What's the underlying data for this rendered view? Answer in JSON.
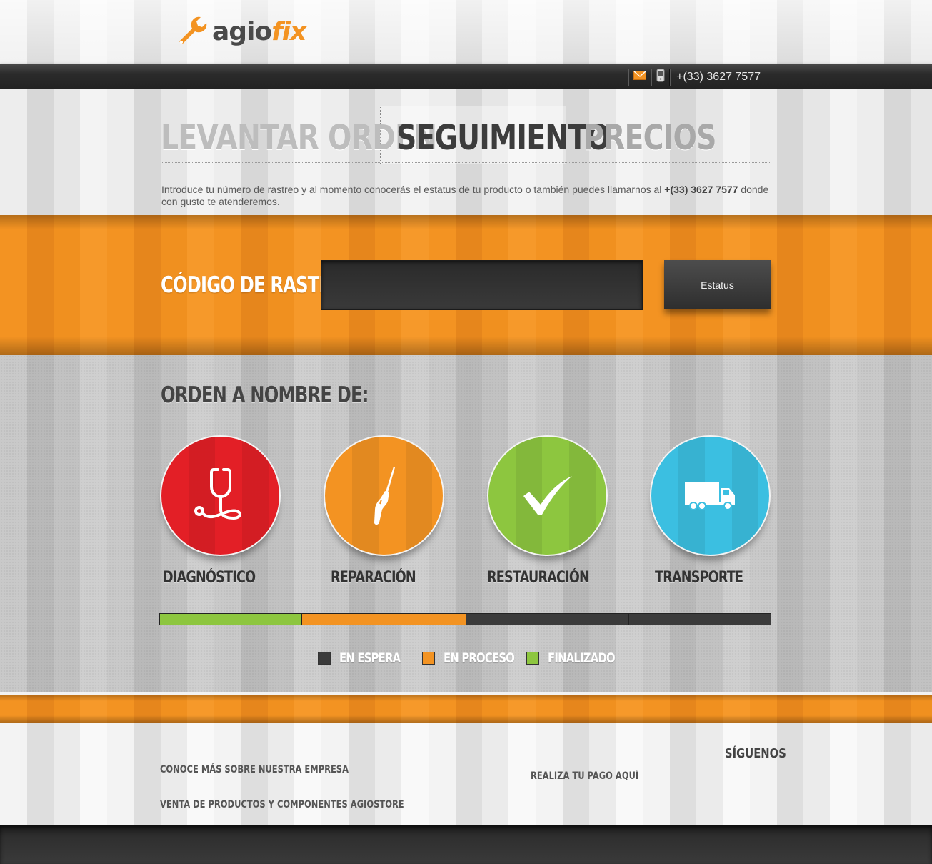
{
  "brand": {
    "name_part1": "agio",
    "name_part2": "fix",
    "primary_color": "#f39322",
    "dark_color": "#3c3c3c"
  },
  "topbar": {
    "phone": "+(33) 3627 7577",
    "icons": [
      "mail-icon",
      "mobile-phone-icon"
    ]
  },
  "tabs": [
    {
      "label": "LEVANTAR ORDEN",
      "active": false
    },
    {
      "label": "SEGUIMIENTO",
      "active": true
    },
    {
      "label": "PRECIOS",
      "active": false
    }
  ],
  "intro": {
    "text_before": "Introduce tu número de rastreo y al momento conocerás el estatus de tu producto o también puedes llamarnos al ",
    "phone": "+(33) 3627 7577",
    "text_after": " donde con gusto te atenderemos."
  },
  "tracking": {
    "label": "CÓDIGO DE RASTREO",
    "input_value": "",
    "input_placeholder": "",
    "button_label": "Estatus"
  },
  "order": {
    "title": "ORDEN A NOMBRE DE:"
  },
  "stages": [
    {
      "label": "DIAGNÓSTICO",
      "icon": "stethoscope-icon",
      "color": "#e31f26",
      "status": "finalizado"
    },
    {
      "label": "REPARACIÓN",
      "icon": "screwdriver-icon",
      "color": "#f39322",
      "status": "en proceso"
    },
    {
      "label": "RESTAURACIÓN",
      "icon": "checkmark-icon",
      "color": "#8dc63f",
      "status": "en espera"
    },
    {
      "label": "TRANSPORTE",
      "icon": "truck-icon",
      "color": "#3bbfe1",
      "status": "en espera"
    }
  ],
  "legend": [
    {
      "label": "EN ESPERA",
      "color": "#3b3b3b"
    },
    {
      "label": "EN PROCESO",
      "color": "#f39322"
    },
    {
      "label": "FINALIZADO",
      "color": "#8dc63f"
    }
  ],
  "footer": {
    "link_company": "CONOCE MÁS SOBRE NUESTRA EMPRESA",
    "link_store": "VENTA DE PRODUCTOS Y COMPONENTES AGIOSTORE",
    "link_payment": "REALIZA TU PAGO AQUÍ",
    "follow": "SÍGUENOS"
  }
}
